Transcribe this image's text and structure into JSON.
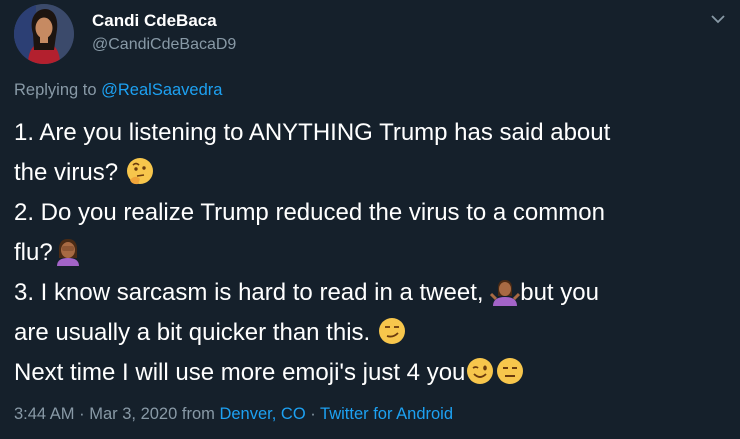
{
  "author": {
    "name": "Candi CdeBaca",
    "handle": "@CandiCdeBacaD9"
  },
  "reply": {
    "prefix": "Replying to ",
    "to": "@RealSaavedra"
  },
  "tweet_lines": [
    "1. Are you listening to ANYTHING Trump has said about",
    "the virus? ",
    "2. Do you realize Trump reduced the virus to a common",
    "flu?",
    "3. I know sarcasm is hard to read in a tweet, ",
    "but you",
    "are usually a bit quicker than this. ",
    "Next time I will use more emoji's just 4 you"
  ],
  "emojis": [
    "thinking-face",
    "woman-facepalming",
    "woman-shrugging",
    "smirking-face",
    "winking-face",
    "expressionless-face"
  ],
  "meta": {
    "time": "3:44 AM",
    "sep1": " · ",
    "date": "Mar 3, 2020",
    "from": " from ",
    "location": "Denver, CO",
    "sep2": " · ",
    "source": "Twitter for Android"
  },
  "colors": {
    "background": "#15202b",
    "text": "#ffffff",
    "muted": "#8899a6",
    "link": "#1da1f2"
  }
}
